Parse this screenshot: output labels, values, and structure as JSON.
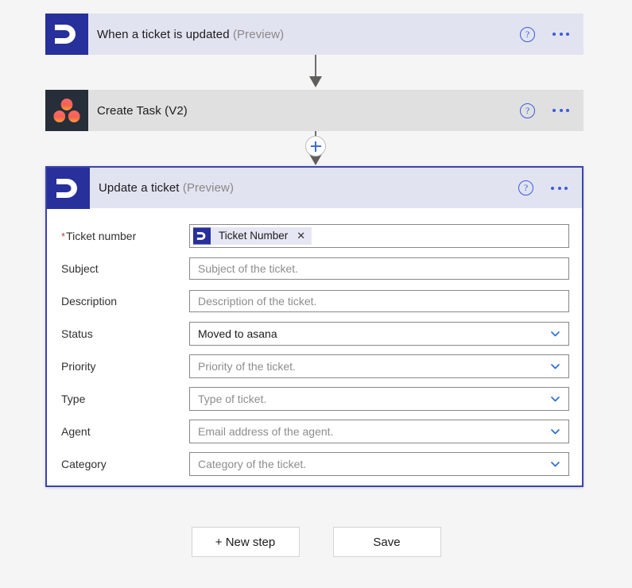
{
  "colors": {
    "canvas_bg": "#f5f5f5",
    "trigger_card_bg": "#e1e3f1",
    "action_card_bg": "#e0e0e0",
    "selected_border": "#3b44ac",
    "accent_blue": "#3b5bdb",
    "freshdesk_blue": "#27309b",
    "asana_navy": "#262e39",
    "asana_dot": "#f8644d",
    "required_red": "#d13438",
    "placeholder_grey": "#8d8d8d"
  },
  "flow": {
    "trigger": {
      "icon": "freshdesk-icon",
      "title": "When a ticket is updated",
      "preview_tag": "(Preview)",
      "help_label": "?",
      "menu_label": "…"
    },
    "action": {
      "icon": "asana-icon",
      "title": "Create Task (V2)",
      "preview_tag": "",
      "help_label": "?",
      "menu_label": "…"
    },
    "insert_step": {
      "label": "+",
      "name": "insert-new-step-button"
    },
    "selected_action": {
      "icon": "freshdesk-icon",
      "title": "Update a ticket",
      "preview_tag": "(Preview)",
      "help_label": "?",
      "menu_label": "…"
    }
  },
  "form": {
    "fields": [
      {
        "label": "Ticket number",
        "required": true,
        "type": "token",
        "token": {
          "icon": "freshdesk-icon",
          "text": "Ticket Number",
          "remove_label": "✕"
        },
        "placeholder": "",
        "value": "",
        "has_chevron": false
      },
      {
        "label": "Subject",
        "required": false,
        "type": "text",
        "placeholder": "Subject of the ticket.",
        "value": "",
        "has_chevron": false
      },
      {
        "label": "Description",
        "required": false,
        "type": "text",
        "placeholder": "Description of the ticket.",
        "value": "",
        "has_chevron": false
      },
      {
        "label": "Status",
        "required": false,
        "type": "dropdown",
        "placeholder": "",
        "value": "Moved to asana",
        "has_chevron": true
      },
      {
        "label": "Priority",
        "required": false,
        "type": "dropdown",
        "placeholder": "Priority of the ticket.",
        "value": "",
        "has_chevron": true
      },
      {
        "label": "Type",
        "required": false,
        "type": "dropdown",
        "placeholder": "Type of ticket.",
        "value": "",
        "has_chevron": true
      },
      {
        "label": "Agent",
        "required": false,
        "type": "dropdown",
        "placeholder": "Email address of the agent.",
        "value": "",
        "has_chevron": true
      },
      {
        "label": "Category",
        "required": false,
        "type": "dropdown",
        "placeholder": "Category of the ticket.",
        "value": "",
        "has_chevron": true
      }
    ]
  },
  "footer": {
    "new_step_label": "+ New step",
    "save_label": "Save"
  }
}
